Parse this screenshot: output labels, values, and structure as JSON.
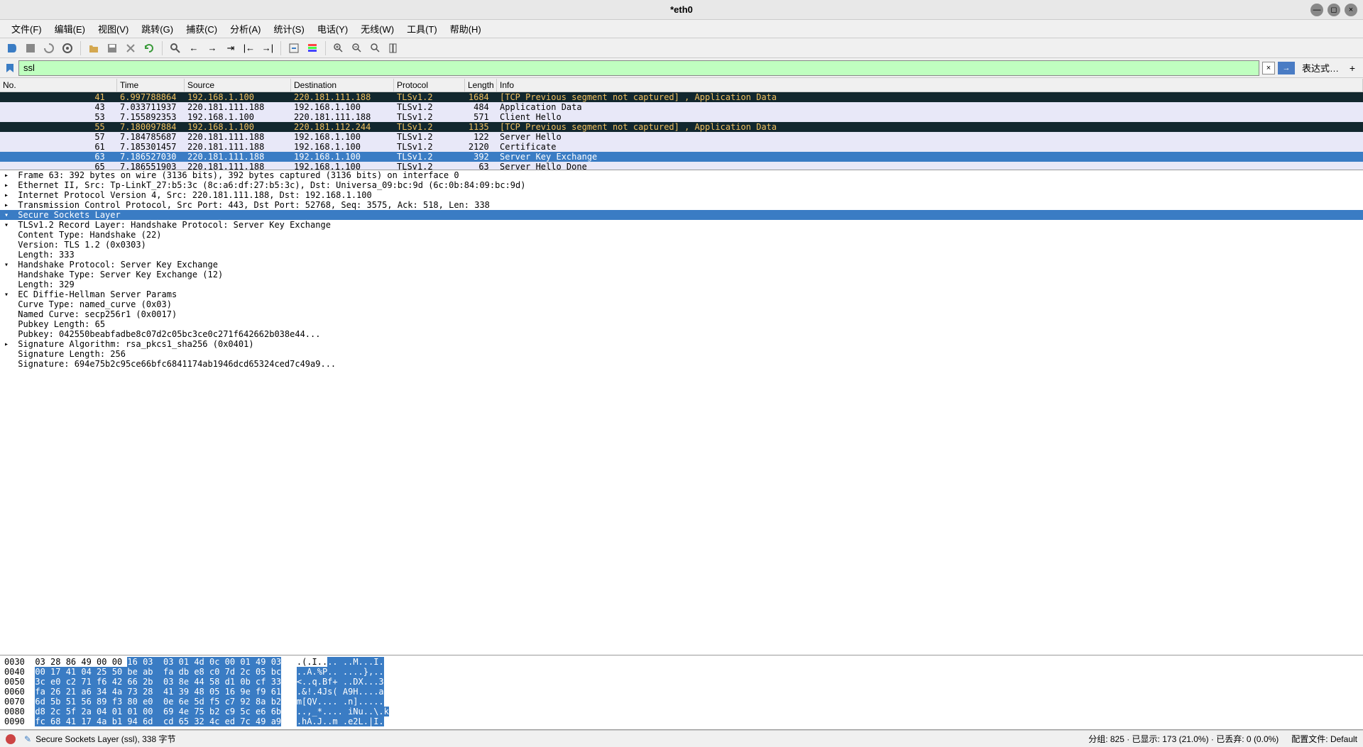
{
  "title": "*eth0",
  "menu": [
    "文件(F)",
    "编辑(E)",
    "视图(V)",
    "跳转(G)",
    "捕获(C)",
    "分析(A)",
    "统计(S)",
    "电话(Y)",
    "无线(W)",
    "工具(T)",
    "帮助(H)"
  ],
  "filter": {
    "value": "ssl",
    "expr_label": "表达式…"
  },
  "columns": {
    "no": "No.",
    "time": "Time",
    "source": "Source",
    "dest": "Destination",
    "proto": "Protocol",
    "len": "Length",
    "info": "Info"
  },
  "packets": [
    {
      "no": "41",
      "time": "6.997788864",
      "src": "192.168.1.100",
      "dst": "220.181.111.188",
      "proto": "TLSv1.2",
      "len": "1684",
      "info": "[TCP Previous segment not captured] , Application Data",
      "cls": "warn"
    },
    {
      "no": "43",
      "time": "7.033711937",
      "src": "220.181.111.188",
      "dst": "192.168.1.100",
      "proto": "TLSv1.2",
      "len": "484",
      "info": "Application Data",
      "cls": "normal"
    },
    {
      "no": "53",
      "time": "7.155892353",
      "src": "192.168.1.100",
      "dst": "220.181.111.188",
      "proto": "TLSv1.2",
      "len": "571",
      "info": "Client Hello",
      "cls": "normal"
    },
    {
      "no": "55",
      "time": "7.180097884",
      "src": "192.168.1.100",
      "dst": "220.181.112.244",
      "proto": "TLSv1.2",
      "len": "1135",
      "info": "[TCP Previous segment not captured] , Application Data",
      "cls": "warn"
    },
    {
      "no": "57",
      "time": "7.184785687",
      "src": "220.181.111.188",
      "dst": "192.168.1.100",
      "proto": "TLSv1.2",
      "len": "122",
      "info": "Server Hello",
      "cls": "normal"
    },
    {
      "no": "61",
      "time": "7.185301457",
      "src": "220.181.111.188",
      "dst": "192.168.1.100",
      "proto": "TLSv1.2",
      "len": "2120",
      "info": "Certificate",
      "cls": "normal"
    },
    {
      "no": "63",
      "time": "7.186527030",
      "src": "220.181.111.188",
      "dst": "192.168.1.100",
      "proto": "TLSv1.2",
      "len": "392",
      "info": "Server Key Exchange",
      "cls": "selected"
    },
    {
      "no": "65",
      "time": "7.186551903",
      "src": "220.181.111.188",
      "dst": "192.168.1.100",
      "proto": "TLSv1.2",
      "len": "63",
      "info": "Server Hello Done",
      "cls": "normal"
    }
  ],
  "details": [
    {
      "indent": 0,
      "exp": "▸",
      "text": "Frame 63: 392 bytes on wire (3136 bits), 392 bytes captured (3136 bits) on interface 0"
    },
    {
      "indent": 0,
      "exp": "▸",
      "text": "Ethernet II, Src: Tp-LinkT_27:b5:3c (8c:a6:df:27:b5:3c), Dst: Universa_09:bc:9d (6c:0b:84:09:bc:9d)"
    },
    {
      "indent": 0,
      "exp": "▸",
      "text": "Internet Protocol Version 4, Src: 220.181.111.188, Dst: 192.168.1.100"
    },
    {
      "indent": 0,
      "exp": "▸",
      "text": "Transmission Control Protocol, Src Port: 443, Dst Port: 52768, Seq: 3575, Ack: 518, Len: 338"
    },
    {
      "indent": 0,
      "exp": "▾",
      "text": "Secure Sockets Layer",
      "sel": true
    },
    {
      "indent": 1,
      "exp": "▾",
      "text": "TLSv1.2 Record Layer: Handshake Protocol: Server Key Exchange"
    },
    {
      "indent": 2,
      "exp": " ",
      "text": "Content Type: Handshake (22)"
    },
    {
      "indent": 2,
      "exp": " ",
      "text": "Version: TLS 1.2 (0x0303)"
    },
    {
      "indent": 2,
      "exp": " ",
      "text": "Length: 333"
    },
    {
      "indent": 2,
      "exp": "▾",
      "text": "Handshake Protocol: Server Key Exchange"
    },
    {
      "indent": 3,
      "exp": " ",
      "text": "Handshake Type: Server Key Exchange (12)"
    },
    {
      "indent": 3,
      "exp": " ",
      "text": "Length: 329"
    },
    {
      "indent": 3,
      "exp": "▾",
      "text": "EC Diffie-Hellman Server Params"
    },
    {
      "indent": 4,
      "exp": " ",
      "text": "Curve Type: named_curve (0x03)"
    },
    {
      "indent": 4,
      "exp": " ",
      "text": "Named Curve: secp256r1 (0x0017)"
    },
    {
      "indent": 4,
      "exp": " ",
      "text": "Pubkey Length: 65"
    },
    {
      "indent": 4,
      "exp": " ",
      "text": "Pubkey: 042550beabfadbe8c07d2c05bc3ce0c271f642662b038e44..."
    },
    {
      "indent": 4,
      "exp": "▸",
      "text": "Signature Algorithm: rsa_pkcs1_sha256 (0x0401)"
    },
    {
      "indent": 4,
      "exp": " ",
      "text": "Signature Length: 256"
    },
    {
      "indent": 4,
      "exp": " ",
      "text": "Signature: 694e75b2c95ce66bfc6841174ab1946dcd65324ced7c49a9..."
    }
  ],
  "hex": [
    {
      "off": "0030",
      "pre": "03 28 86 49 00 00 ",
      "sel": "16 03  03 01 4d 0c 00 01 49 03",
      "asciiPre": ".(.I..",
      "asciiSel": ".. ..M...I."
    },
    {
      "off": "0040",
      "pre": "",
      "sel": "00 17 41 04 25 50 be ab  fa db e8 c0 7d 2c 05 bc",
      "asciiPre": "",
      "asciiSel": "..A.%P.. ....},.."
    },
    {
      "off": "0050",
      "pre": "",
      "sel": "3c e0 c2 71 f6 42 66 2b  03 8e 44 58 d1 0b cf 33",
      "asciiPre": "",
      "asciiSel": "<..q.Bf+ ..DX...3"
    },
    {
      "off": "0060",
      "pre": "",
      "sel": "fa 26 21 a6 34 4a 73 28  41 39 48 05 16 9e f9 61",
      "asciiPre": "",
      "asciiSel": ".&!.4Js( A9H....a"
    },
    {
      "off": "0070",
      "pre": "",
      "sel": "6d 5b 51 56 89 f3 80 e0  0e 6e 5d f5 c7 92 8a b2",
      "asciiPre": "",
      "asciiSel": "m[QV.... .n]....."
    },
    {
      "off": "0080",
      "pre": "",
      "sel": "d8 2c 5f 2a 04 01 01 00  69 4e 75 b2 c9 5c e6 6b",
      "asciiPre": "",
      "asciiSel": "..,_*.... iNu..\\.k"
    },
    {
      "off": "0090",
      "pre": "",
      "sel": "fc 68 41 17 4a b1 94 6d  cd 65 32 4c ed 7c 49 a9",
      "asciiPre": "",
      "asciiSel": ".hA.J..m .e2L.|I."
    }
  ],
  "status": {
    "left": "Secure Sockets Layer (ssl), 338 字节",
    "packets": "分组: 825 · 已显示: 173 (21.0%) · 已丢弃: 0 (0.0%)",
    "profile": "配置文件: Default"
  }
}
